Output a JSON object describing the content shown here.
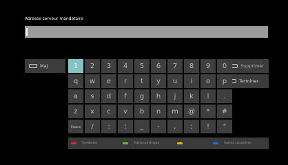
{
  "dialog": {
    "title": "Adresse serveur mandataire",
    "input_value": ""
  },
  "buttons": {
    "maj": "Maj",
    "supprimer": "Supprimer",
    "terminer": "Terminer"
  },
  "keyboard": {
    "rows": [
      [
        "1",
        "2",
        "3",
        "4",
        "5",
        "6",
        "7",
        "8",
        "9",
        "0"
      ],
      [
        "q",
        "w",
        "e",
        "r",
        "t",
        "y",
        "u",
        "i",
        "o",
        "p"
      ],
      [
        "a",
        "s",
        "d",
        "f",
        "g",
        "h",
        "j",
        "k",
        "l",
        "."
      ],
      [
        "z",
        "x",
        "c",
        "v",
        "b",
        "n",
        "m",
        "@",
        "*",
        "#"
      ],
      [
        "Espace",
        "/",
        ":",
        ";",
        "_",
        "-",
        ",",
        ";",
        "!",
        "\""
      ]
    ],
    "focused_key": "1"
  },
  "footer": {
    "items": [
      {
        "label": "Symboles",
        "color": "#e2233b"
      },
      {
        "label": "Alphanumérique",
        "color": "#73b62a"
      },
      {
        "label": "",
        "color": "#f0b400"
      },
      {
        "label": "Autres caractères",
        "color": "#1e73d2"
      }
    ]
  },
  "colors": {
    "background": "#000000",
    "key_bg": "#3f3f3f",
    "focus": "#7fc5c4",
    "input_bg": "#9b9b9b"
  },
  "icons": {
    "maj": "ok-key-icon",
    "supprimer": "back-key-icon",
    "terminer": "ok-key-icon"
  }
}
